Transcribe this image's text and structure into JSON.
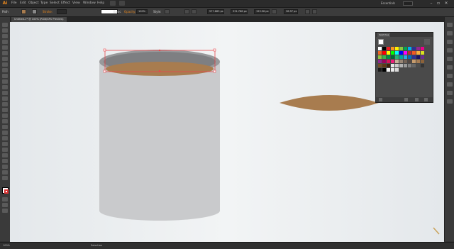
{
  "app": {
    "logo": "Ai"
  },
  "menu": {
    "items": [
      "File",
      "Edit",
      "Object",
      "Type",
      "Select",
      "Effect",
      "View",
      "Window",
      "Help"
    ]
  },
  "workspace": {
    "label": "Essentials"
  },
  "control": {
    "selection_label": "Path",
    "stroke_label": "Stroke:",
    "basic_label": "Basic",
    "opacity_label": "Opacity:",
    "opacity_value": "100%",
    "style_label": "Style:",
    "x_value": "577.683 px",
    "y_value": "331.768 px",
    "w_value": "153.96 px",
    "h_value": "38.97 px"
  },
  "document": {
    "tab_title": "Untitled-1* @ 100% (RGB/GPU Preview)"
  },
  "status": {
    "zoom": "100%",
    "tool": "Selection"
  },
  "panel": {
    "title": "Swatches"
  },
  "colors": {
    "accent": "#e8871e",
    "fill_brown": "#a87c4f",
    "cup_gray": "#c9cacc",
    "panel_bg": "#4a4a4a"
  },
  "swatches": [
    "#ffffff",
    "#000000",
    "#ed1c24",
    "#f7941d",
    "#fff200",
    "#8dc63f",
    "#00a651",
    "#00aeef",
    "#2e3192",
    "#92278f",
    "#ec008c",
    "#f26522",
    "#ff0000",
    "#ffff00",
    "#00ff00",
    "#00ffff",
    "#0000ff",
    "#ff00ff",
    "#c1272d",
    "#f15a24",
    "#fbb03b",
    "#d9e021",
    "#8cc63f",
    "#39b54a",
    "#009245",
    "#006837",
    "#22b573",
    "#00a99d",
    "#29abe2",
    "#0071bc",
    "#2e3192",
    "#1b1464",
    "#662d91",
    "#93278f",
    "#9e005d",
    "#d4145a",
    "#ed1e79",
    "#c7b299",
    "#998675",
    "#736357",
    "#534741",
    "#c69c6d",
    "#a67c52",
    "#8c6239",
    "#754c24",
    "#603813",
    "#42210b",
    "#e6e6e6",
    "#cccccc",
    "#b3b3b3",
    "#999999",
    "#808080",
    "#666666",
    "#4d4d4d",
    "#333333",
    "#1a1a1a",
    "#000000",
    "#f2f2f2",
    "#ebebeb",
    "#d9d9d9"
  ]
}
